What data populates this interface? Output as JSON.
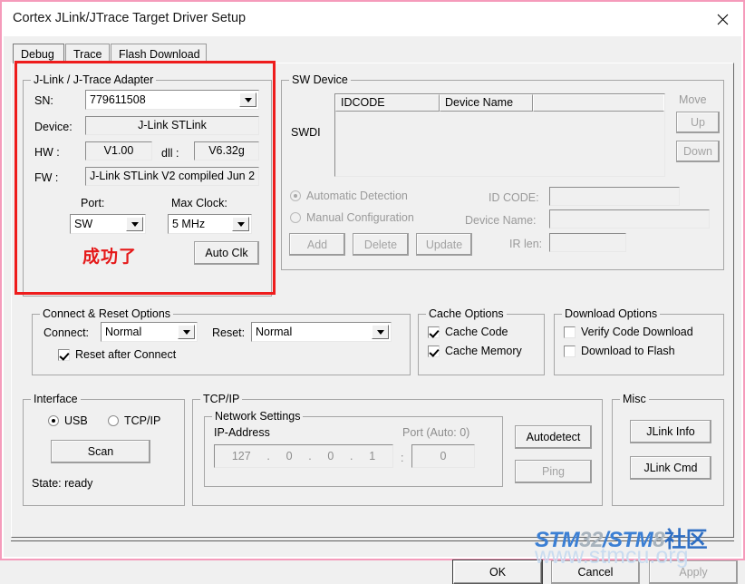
{
  "window": {
    "title": "Cortex JLink/JTrace Target Driver Setup",
    "close_icon": "close-icon"
  },
  "tabs": [
    {
      "label": "Debug",
      "selected": true
    },
    {
      "label": "Trace",
      "selected": false
    },
    {
      "label": "Flash Download",
      "selected": false
    }
  ],
  "adapter": {
    "caption": "J-Link / J-Trace Adapter",
    "sn_label": "SN:",
    "sn_value": "779611508",
    "device_label": "Device:",
    "device_value": "J-Link STLink",
    "hw_label": "HW :",
    "hw_value": "V1.00",
    "dll_label": "dll :",
    "dll_value": "V6.32g",
    "fw_label": "FW :",
    "fw_value": "J-Link STLink V2 compiled Jun 2",
    "port_label": "Port:",
    "port_value": "SW",
    "maxclock_label": "Max Clock:",
    "maxclock_value": "5 MHz",
    "autoclk_label": "Auto Clk",
    "annotation": "成功了"
  },
  "sw_device": {
    "caption": "SW Device",
    "bus_label": "SWDI",
    "columns": [
      "IDCODE",
      "Device Name",
      ""
    ],
    "rows": [],
    "move_label": "Move",
    "up_label": "Up",
    "down_label": "Down",
    "automatic_detection_label": "Automatic Detection",
    "manual_configuration_label": "Manual Configuration",
    "automatic_detection_selected": true,
    "add_label": "Add",
    "delete_label": "Delete",
    "update_label": "Update",
    "idcode_label": "ID CODE:",
    "idcode_value": "",
    "device_name_label": "Device Name:",
    "device_name_value": "",
    "irlen_label": "IR len:",
    "irlen_value": ""
  },
  "connect_reset": {
    "caption": "Connect & Reset Options",
    "connect_label": "Connect:",
    "connect_value": "Normal",
    "reset_label": "Reset:",
    "reset_value": "Normal",
    "reset_after_connect_label": "Reset after Connect",
    "reset_after_connect_checked": true
  },
  "cache_options": {
    "caption": "Cache Options",
    "cache_code_label": "Cache Code",
    "cache_code_checked": true,
    "cache_memory_label": "Cache Memory",
    "cache_memory_checked": true
  },
  "download_options": {
    "caption": "Download Options",
    "verify_code_download_label": "Verify Code Download",
    "verify_code_download_checked": false,
    "download_to_flash_label": "Download to Flash",
    "download_to_flash_checked": false
  },
  "interface": {
    "caption": "Interface",
    "usb_label": "USB",
    "tcpip_label": "TCP/IP",
    "selected": "USB",
    "scan_label": "Scan",
    "state_label": "State: ready"
  },
  "tcpip": {
    "caption": "TCP/IP",
    "network_settings_caption": "Network Settings",
    "ip_address_label": "IP-Address",
    "ip_octets": [
      "127",
      "0",
      "0",
      "1"
    ],
    "port_label": "Port (Auto: 0)",
    "port_value": "0",
    "colon": ":",
    "autodetect_label": "Autodetect",
    "ping_label": "Ping"
  },
  "misc": {
    "caption": "Misc",
    "jlink_info_label": "JLink Info",
    "jlink_cmd_label": "JLink Cmd"
  },
  "footer": {
    "ok_label": "OK",
    "cancel_label": "Cancel",
    "apply_label": "Apply"
  },
  "watermark": {
    "part1": "STM",
    "part2": "32",
    "part3": "/",
    "part4": "STM",
    "part5": "8",
    "part6": "社区",
    "line2": "www.stmcu.org"
  },
  "colors": {
    "annotation_red": "#ee1c1c",
    "watermark_blue": "#3b7fd4",
    "window_border": "#f59bbb"
  }
}
